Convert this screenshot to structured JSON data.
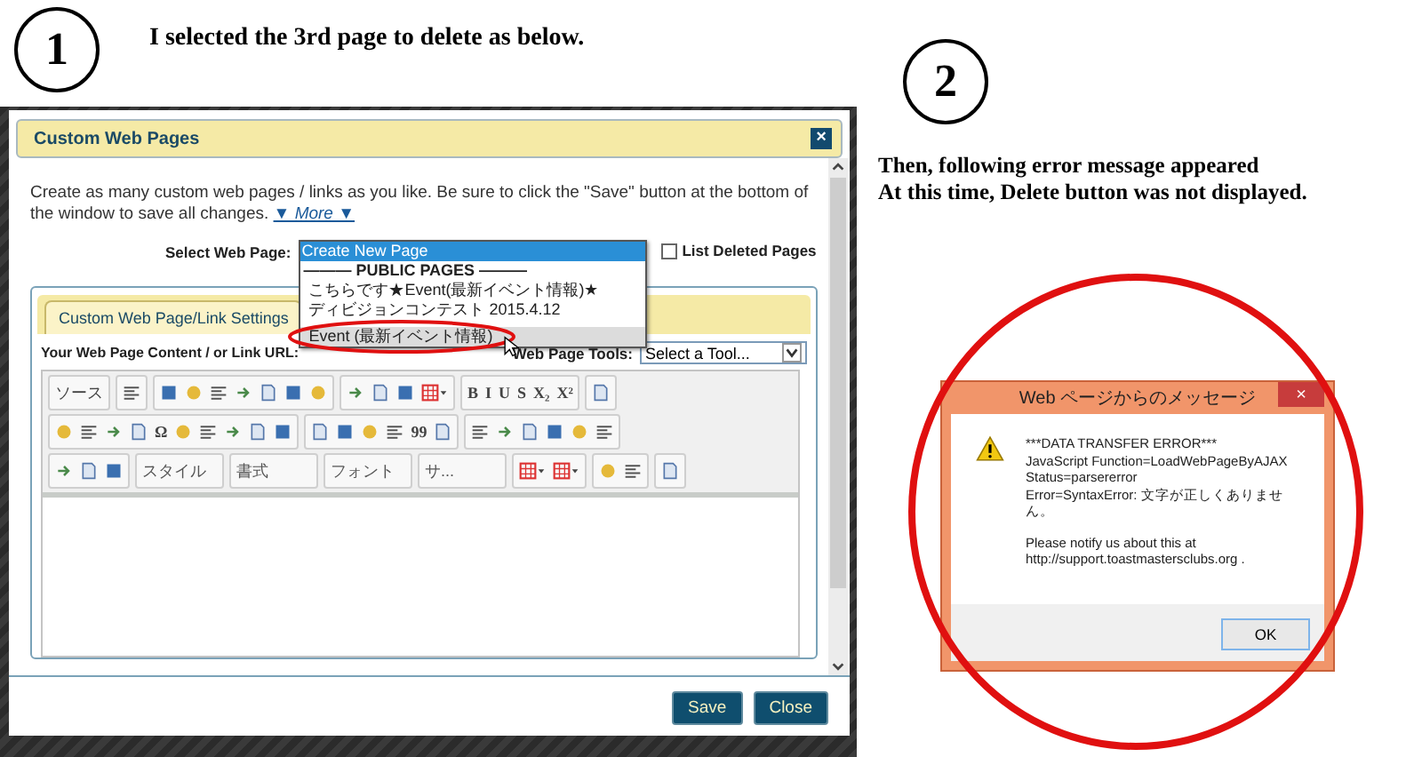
{
  "step_1": {
    "number": "1",
    "caption": "I selected the 3rd page to delete as below."
  },
  "step_2": {
    "number": "2",
    "caption_lines": [
      "Then, following error message appeared",
      "At this time, Delete button was not displayed."
    ]
  },
  "dialog": {
    "title": "Custom Web Pages",
    "close": "×",
    "intro": "Create as many custom web pages / links as you like. Be sure to click the \"Save\" button at the bottom of the window to save all changes.",
    "more_link": "▼ More ▼",
    "select_label": "Select Web Page:",
    "options": [
      {
        "kind": "option",
        "label": "Create New Page",
        "selected": true,
        "hovered": false
      },
      {
        "kind": "group",
        "label": "——— PUBLIC PAGES ———",
        "selected": false,
        "hovered": false
      },
      {
        "kind": "option",
        "label": "こちらです★Event(最新イベント情報)★",
        "selected": false,
        "hovered": false
      },
      {
        "kind": "option",
        "label": "ディビジョンコンテスト 2015.4.12",
        "selected": false,
        "hovered": false
      },
      {
        "kind": "option",
        "label": "Event (最新イベント情報)",
        "selected": false,
        "hovered": true
      }
    ],
    "list_deleted": {
      "label": "List Deleted Pages",
      "checked": false
    },
    "tabs": [
      {
        "label": "Custom Web Page/Link Settings",
        "selected": true
      }
    ],
    "content_label": "Your Web Page Content / or Link URL:",
    "tools_label": "Web Page Tools:",
    "tools_value": "Select a Tool...",
    "toolbar_rows": [
      [
        [
          {
            "kind": "text",
            "label": "ソース"
          }
        ],
        [
          {
            "kind": "icon"
          }
        ],
        [
          {
            "kind": "icon"
          },
          {
            "kind": "icon"
          },
          {
            "kind": "icon"
          },
          {
            "kind": "icon"
          },
          {
            "kind": "icon"
          },
          {
            "kind": "icon"
          },
          {
            "kind": "icon"
          }
        ],
        [
          {
            "kind": "icon"
          },
          {
            "kind": "icon"
          },
          {
            "kind": "icon"
          },
          {
            "kind": "menu"
          }
        ],
        [
          {
            "kind": "text",
            "label": "B"
          },
          {
            "kind": "text",
            "label": "I"
          },
          {
            "kind": "text",
            "label": "U"
          },
          {
            "kind": "text",
            "label": "S"
          },
          {
            "kind": "text",
            "label": "X₂"
          },
          {
            "kind": "text",
            "label": "X²"
          }
        ],
        [
          {
            "kind": "icon"
          }
        ]
      ],
      [
        [
          {
            "kind": "icon"
          },
          {
            "kind": "icon"
          },
          {
            "kind": "icon"
          },
          {
            "kind": "icon"
          },
          {
            "kind": "text",
            "label": "Ω"
          },
          {
            "kind": "icon"
          },
          {
            "kind": "icon"
          },
          {
            "kind": "icon"
          },
          {
            "kind": "icon"
          },
          {
            "kind": "icon"
          }
        ],
        [
          {
            "kind": "icon"
          },
          {
            "kind": "icon"
          },
          {
            "kind": "icon"
          },
          {
            "kind": "icon"
          },
          {
            "kind": "text",
            "label": "99"
          },
          {
            "kind": "icon"
          }
        ],
        [
          {
            "kind": "icon"
          },
          {
            "kind": "icon"
          },
          {
            "kind": "icon"
          },
          {
            "kind": "icon"
          },
          {
            "kind": "icon"
          },
          {
            "kind": "icon"
          }
        ]
      ],
      [
        [
          {
            "kind": "icon"
          },
          {
            "kind": "icon"
          },
          {
            "kind": "icon"
          }
        ],
        [
          {
            "kind": "combo",
            "label": "スタイル"
          }
        ],
        [
          {
            "kind": "combo",
            "label": "書式"
          }
        ],
        [
          {
            "kind": "combo",
            "label": "フォント"
          }
        ],
        [
          {
            "kind": "combo",
            "label": "サ..."
          }
        ],
        [
          {
            "kind": "menu"
          },
          {
            "kind": "menu"
          }
        ],
        [
          {
            "kind": "icon"
          },
          {
            "kind": "icon"
          }
        ],
        [
          {
            "kind": "icon"
          }
        ]
      ]
    ],
    "buttons": [
      "Save",
      "Close"
    ]
  },
  "error_dialog": {
    "title": "Web ページからのメッセージ",
    "close": "×",
    "lines": [
      "***DATA TRANSFER ERROR***",
      "JavaScript Function=LoadWebPageByAJAX",
      "Status=parsererror",
      "Error=SyntaxError: 文字が正しくありません。"
    ],
    "notice_lines": [
      "Please notify us about this at",
      "http://support.toastmastersclubs.org ."
    ],
    "button": "OK"
  }
}
